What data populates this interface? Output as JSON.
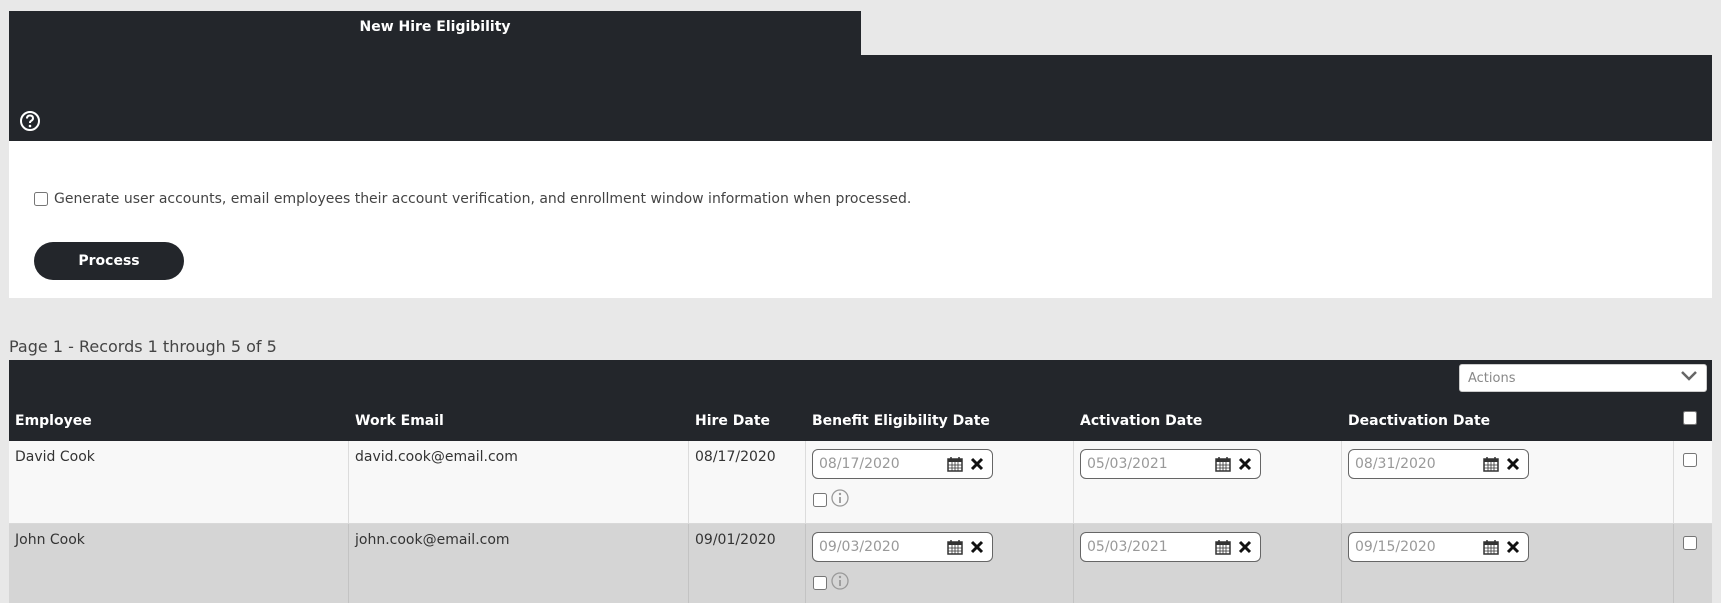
{
  "tab": {
    "title": "New Hire Eligibility"
  },
  "icons": {
    "help": "help-circle-icon",
    "calendar": "calendar-icon",
    "clear": "close-icon",
    "info": "info-icon",
    "dropdown": "chevron-down-icon"
  },
  "options": {
    "generate_label": "Generate user accounts, email employees their account verification, and enrollment window information when processed.",
    "process_label": "Process"
  },
  "records_summary": "Page 1 - Records 1 through 5 of 5",
  "grid": {
    "actions_label": "Actions",
    "columns": [
      "Employee",
      "Work Email",
      "Hire Date",
      "Benefit Eligibility Date",
      "Activation Date",
      "Deactivation Date"
    ],
    "rows": [
      {
        "employee": "David Cook",
        "email": "david.cook@email.com",
        "hire_date": "08/17/2020",
        "benefit_date": "08/17/2020",
        "activation_date": "05/03/2021",
        "deactivation_date": "08/31/2020"
      },
      {
        "employee": "John Cook",
        "email": "john.cook@email.com",
        "hire_date": "09/01/2020",
        "benefit_date": "09/03/2020",
        "activation_date": "05/03/2021",
        "deactivation_date": "09/15/2020"
      }
    ]
  },
  "colors": {
    "dark": "#23262b",
    "page_bg": "#e8e8e8",
    "row_odd": "#f8f8f8",
    "row_even": "#d5d5d5"
  }
}
